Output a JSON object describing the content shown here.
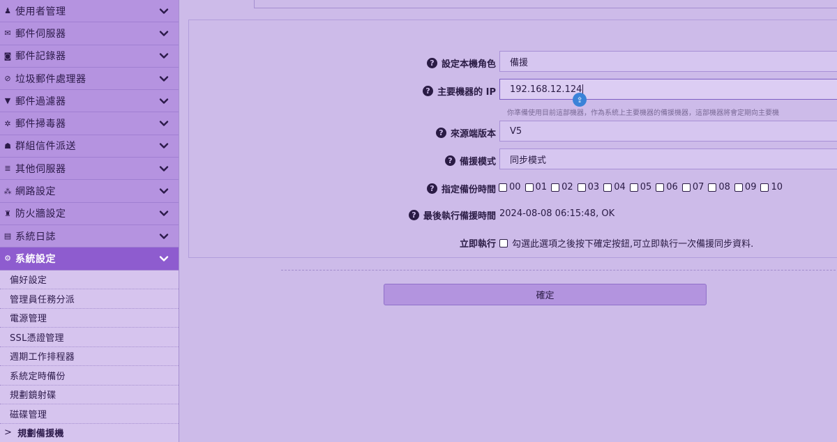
{
  "sidebar": {
    "menu": [
      {
        "label": "使用者管理",
        "icon": "user-icon",
        "glyph": "♟"
      },
      {
        "label": "郵件伺服器",
        "icon": "envelope-icon",
        "glyph": "✉"
      },
      {
        "label": "郵件記錄器",
        "icon": "camera-icon",
        "glyph": "◙"
      },
      {
        "label": "垃圾郵件處理器",
        "icon": "ban-icon",
        "glyph": "⊘"
      },
      {
        "label": "郵件過濾器",
        "icon": "filter-icon",
        "glyph": "▼"
      },
      {
        "label": "郵件掃毒器",
        "icon": "bug-icon",
        "glyph": "✲"
      },
      {
        "label": "群組信件派送",
        "icon": "users-icon",
        "glyph": "☗"
      },
      {
        "label": "其他伺服器",
        "icon": "server-icon",
        "glyph": "≣"
      },
      {
        "label": "網路設定",
        "icon": "sitemap-icon",
        "glyph": "⁂"
      },
      {
        "label": "防火牆設定",
        "icon": "fire-icon",
        "glyph": "♜"
      },
      {
        "label": "系統日誌",
        "icon": "log-icon",
        "glyph": "▤"
      },
      {
        "label": "系統設定",
        "icon": "gears-icon",
        "glyph": "⚙"
      }
    ],
    "submenu": [
      {
        "label": "偏好設定"
      },
      {
        "label": "管理員任務分派"
      },
      {
        "label": "電源管理"
      },
      {
        "label": "SSL憑證管理"
      },
      {
        "label": "週期工作排程器"
      },
      {
        "label": "系統定時備份"
      },
      {
        "label": "規劃鏡射碟"
      },
      {
        "label": "磁碟管理"
      },
      {
        "label": "規劃備援機"
      }
    ],
    "current_arrow": ">"
  },
  "form": {
    "role_label": "設定本機角色",
    "role_value": "備援",
    "primary_ip_label": "主要機器的 IP",
    "primary_ip_value": "192.168.12.124",
    "primary_ip_hint": "你準備使用目前這部機器，作為系統上主要機器的備援機器，這部機器將會定期向主要機",
    "source_version_label": "來源端版本",
    "source_version_value": "V5",
    "backup_mode_label": "備援模式",
    "backup_mode_value": "同步模式",
    "schedule_label": "指定備份時間",
    "hours": [
      "00",
      "01",
      "02",
      "03",
      "04",
      "05",
      "06",
      "07",
      "08",
      "09",
      "10"
    ],
    "last_run_label": "最後執行備援時間",
    "last_run_value": "2024-08-08 06:15:48, OK",
    "run_now_label": "立即執行",
    "run_now_text": "勾選此選項之後按下確定按鈕,可立即執行一次備援同步資料."
  },
  "confirm_label": "確定",
  "help_glyph": "?",
  "badge_glyph": "⇪",
  "colors": {
    "active_menu": "#8e5ccf",
    "badge": "#3a82d8"
  }
}
